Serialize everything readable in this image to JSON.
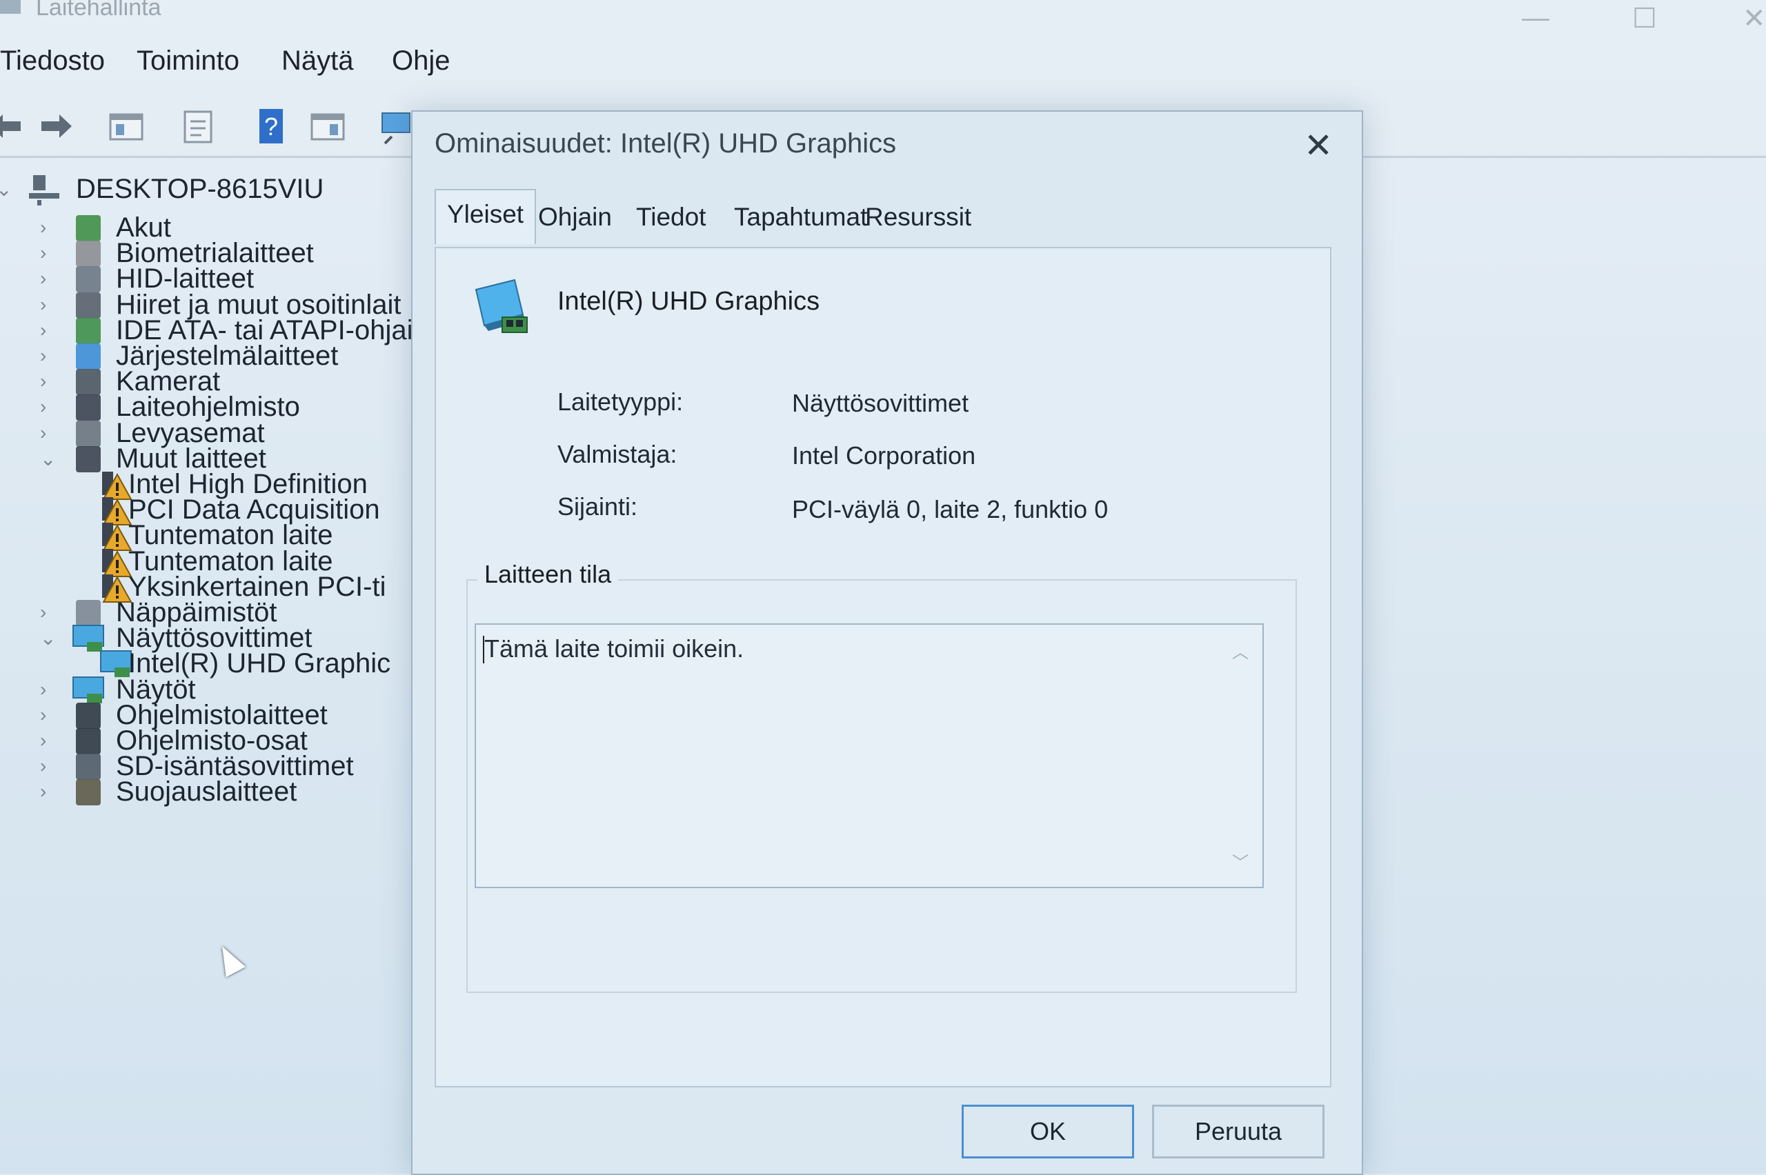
{
  "app": {
    "title": "Laitehallinta",
    "menu": [
      "Tiedosto",
      "Toiminto",
      "Näytä",
      "Ohje"
    ]
  },
  "tree": {
    "root": "DESKTOP-8615VIU",
    "items": [
      {
        "label": "Akut",
        "icon": "battery-icon",
        "expanded": false,
        "level": 1
      },
      {
        "label": "Biometrialaitteet",
        "icon": "fingerprint-icon",
        "expanded": false,
        "level": 1
      },
      {
        "label": "HID-laitteet",
        "icon": "hid-icon",
        "expanded": false,
        "level": 1
      },
      {
        "label": "Hiiret ja muut osoitinlait",
        "icon": "mouse-icon",
        "expanded": false,
        "level": 1
      },
      {
        "label": "IDE ATA- tai ATAPI-ohjain",
        "icon": "ide-controller-icon",
        "expanded": false,
        "level": 1
      },
      {
        "label": "Järjestelmälaitteet",
        "icon": "system-folder-icon",
        "expanded": false,
        "level": 1
      },
      {
        "label": "Kamerat",
        "icon": "camera-icon",
        "expanded": false,
        "level": 1
      },
      {
        "label": "Laiteohjelmisto",
        "icon": "firmware-icon",
        "expanded": false,
        "level": 1
      },
      {
        "label": "Levyasemat",
        "icon": "disk-drive-icon",
        "expanded": false,
        "level": 1
      },
      {
        "label": "Muut laitteet",
        "icon": "unknown-device-icon",
        "expanded": true,
        "level": 1
      },
      {
        "label": "Intel High Definition",
        "icon": "warning-device-icon",
        "level": 2
      },
      {
        "label": "PCI Data Acquisition",
        "icon": "warning-device-icon",
        "level": 2
      },
      {
        "label": "Tuntematon laite",
        "icon": "warning-device-icon",
        "level": 2
      },
      {
        "label": "Tuntematon laite",
        "icon": "warning-device-icon",
        "level": 2
      },
      {
        "label": "Yksinkertainen PCI-ti",
        "icon": "warning-device-icon",
        "level": 2
      },
      {
        "label": "Näppäimistöt",
        "icon": "keyboard-icon",
        "expanded": false,
        "level": 1
      },
      {
        "label": "Näyttösovittimet",
        "icon": "display-adapter-icon",
        "expanded": true,
        "level": 1
      },
      {
        "label": "Intel(R) UHD Graphic",
        "icon": "display-adapter-icon",
        "level": 2
      },
      {
        "label": "Näytöt",
        "icon": "monitor-icon",
        "expanded": false,
        "level": 1
      },
      {
        "label": "Ohjelmistolaitteet",
        "icon": "software-device-icon",
        "expanded": false,
        "level": 1
      },
      {
        "label": "Ohjelmisto-osat",
        "icon": "software-component-icon",
        "expanded": false,
        "level": 1
      },
      {
        "label": "SD-isäntäsovittimet",
        "icon": "sd-host-icon",
        "expanded": false,
        "level": 1
      },
      {
        "label": "Suojauslaitteet",
        "icon": "security-device-icon",
        "expanded": false,
        "level": 1
      }
    ]
  },
  "dialog": {
    "title": "Ominaisuudet: Intel(R) UHD Graphics",
    "tabs": [
      "Yleiset",
      "Ohjain",
      "Tiedot",
      "Tapahtumat",
      "Resurssit"
    ],
    "active_tab": "Yleiset",
    "device_name": "Intel(R) UHD Graphics",
    "props": {
      "type_key": "Laitetyyppi:",
      "type_val": "Näyttösovittimet",
      "mfr_key": "Valmistaja:",
      "mfr_val": "Intel Corporation",
      "loc_key": "Sijainti:",
      "loc_val": "PCI-väylä 0, laite 2, funktio 0"
    },
    "status_label": "Laitteen tila",
    "status_text": "Tämä laite toimii oikein.",
    "ok": "OK",
    "cancel": "Peruuta"
  }
}
